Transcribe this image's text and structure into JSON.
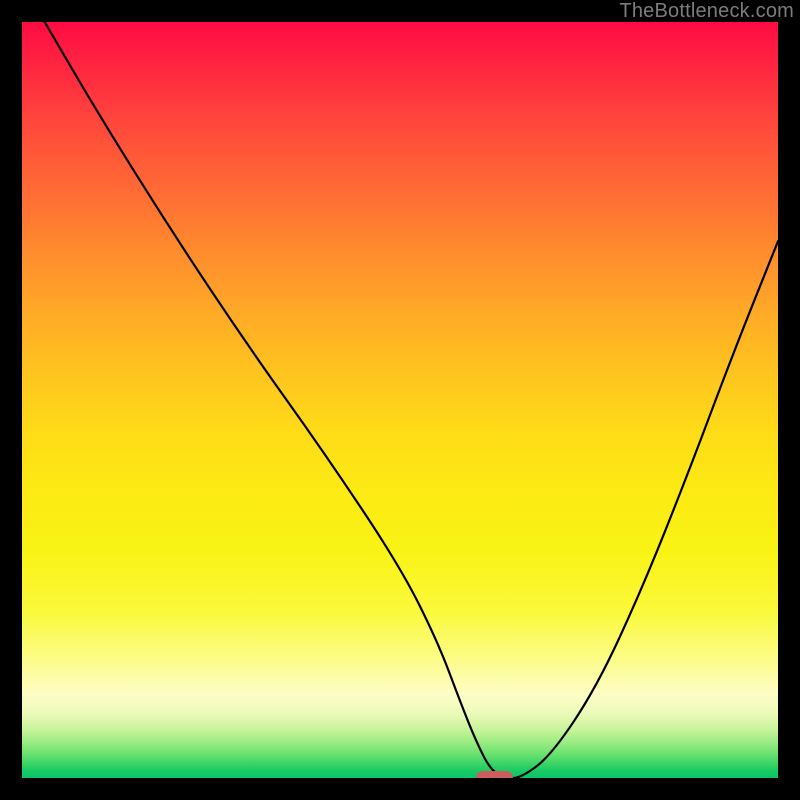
{
  "watermark": "TheBottleneck.com",
  "marker": {
    "color": "#cd5c5c"
  },
  "chart_data": {
    "type": "line",
    "title": "",
    "xlabel": "",
    "ylabel": "",
    "xlim": [
      0,
      100
    ],
    "ylim": [
      0,
      100
    ],
    "grid": false,
    "legend": false,
    "series": [
      {
        "name": "bottleneck-curve",
        "x": [
          3,
          10,
          20,
          30,
          40,
          50,
          55,
          58,
          60,
          62,
          64,
          66,
          70,
          76,
          82,
          88,
          94,
          100
        ],
        "y": [
          100,
          88,
          72,
          57,
          43,
          28,
          18,
          10,
          5,
          1,
          0,
          0,
          3,
          12,
          25,
          40,
          56,
          71
        ]
      }
    ],
    "minimum_marker": {
      "x_start": 60,
      "x_end": 65,
      "y": 0
    },
    "background_gradient": {
      "top": "#ff0b43",
      "mid": "#ffdb18",
      "bottom": "#06c566"
    }
  }
}
